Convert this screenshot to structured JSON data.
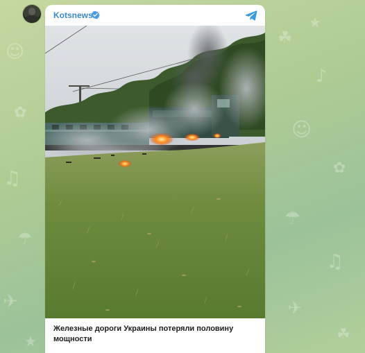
{
  "post": {
    "channel_name": "Kotsnews",
    "caption": "Железные дороги Украины потеряли половину мощности",
    "photo_subject": "burning locomotive on railway beside grass field"
  },
  "icons": {
    "verified": "verified-badge-icon",
    "share": "telegram-share-icon",
    "avatar": "channel-avatar"
  },
  "colors": {
    "channel_name": "#3a89c9",
    "verified_badge": "#4a9be0",
    "share_icon": "#3a9bdc",
    "background": "#aecb94"
  }
}
